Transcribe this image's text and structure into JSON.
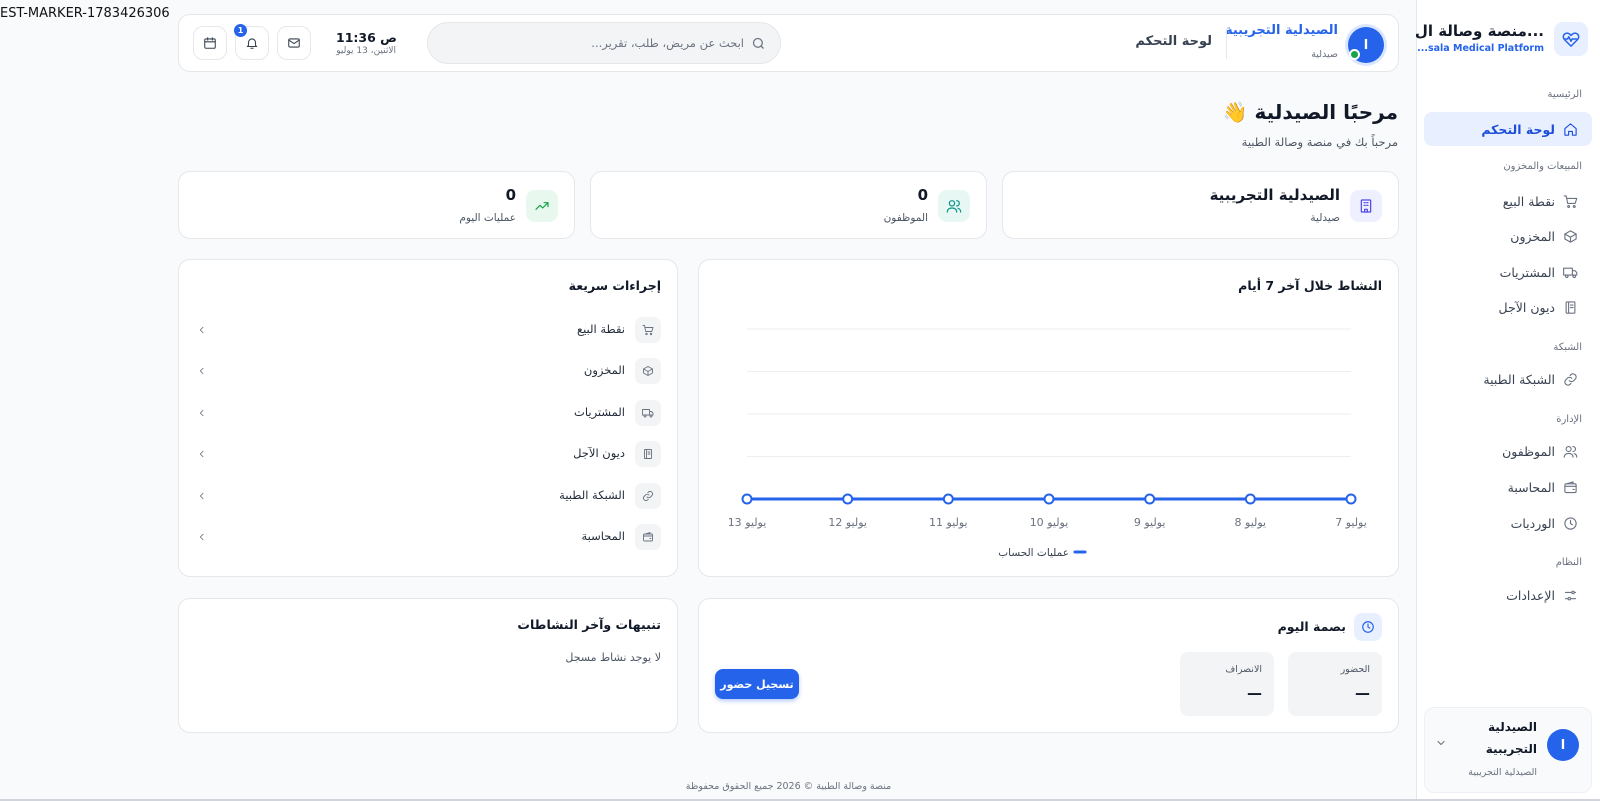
{
  "marker": "EST-MARKER-1783426306",
  "sidebar": {
    "brand_title": "منصة وصالة ال...",
    "brand_sub": "...sala Medical Platform",
    "sections": {
      "home": "الرئيسية",
      "sales": "المبيعات والمخزون",
      "network": "الشبكة",
      "admin": "الإدارة",
      "system": "النظام"
    },
    "items": [
      {
        "label": "لوحة التحكم",
        "icon": "home-icon"
      },
      {
        "label": "نقطة البيع",
        "icon": "cart-icon"
      },
      {
        "label": "المخزون",
        "icon": "box-icon"
      },
      {
        "label": "المشتريات",
        "icon": "truck-icon"
      },
      {
        "label": "ديون الآجل",
        "icon": "ledger-icon"
      },
      {
        "label": "الشبكة الطبية",
        "icon": "link-icon"
      },
      {
        "label": "الموظفون",
        "icon": "users-icon"
      },
      {
        "label": "المحاسبة",
        "icon": "wallet-icon"
      },
      {
        "label": "الورديات",
        "icon": "clock-icon"
      },
      {
        "label": "الإعدادات",
        "icon": "sliders-icon"
      }
    ],
    "user": {
      "avatar": "ا",
      "name": "الصيدلية التجريبية",
      "sub": "الصيدلية التجريبية"
    }
  },
  "header": {
    "avatar": "ا",
    "name": "الصيدلية التجريبية",
    "role": "صيدلية",
    "title": "لوحة التحكم",
    "search_placeholder": "ابحث عن مريض، طلب، تقرير...",
    "time": "11:36 ص",
    "date": "الاثنين، 13 يوليو",
    "notification_count": "1"
  },
  "welcome": {
    "title": "مرحبًا الصيدلية 👋",
    "subtitle": "مرحباً بك في منصة وصالة الطبية"
  },
  "stats": [
    {
      "value": "الصيدلية التجريبية",
      "label": "صيدلية",
      "icon": "building-icon",
      "color": "#4f46e5",
      "bg": "#eef0ff"
    },
    {
      "value": "0",
      "label": "الموظفون",
      "icon": "users-icon",
      "color": "#0d9488",
      "bg": "#e6f7f4"
    },
    {
      "value": "0",
      "label": "عمليات اليوم",
      "icon": "trending-up-icon",
      "color": "#16a34a",
      "bg": "#e8f8ee"
    }
  ],
  "chart": {
    "title": "النشاط خلال آخر 7 أيام",
    "legend": "عمليات الحساب"
  },
  "chart_data": {
    "type": "line",
    "categories": [
      "7 يوليو",
      "8 يوليو",
      "9 يوليو",
      "10 يوليو",
      "11 يوليو",
      "12 يوليو",
      "13 يوليو"
    ],
    "series": [
      {
        "name": "عمليات الحساب",
        "values": [
          0,
          0,
          0,
          0,
          0,
          0,
          0
        ]
      }
    ],
    "x_direction": "right-to-left",
    "grid": true,
    "legend_position": "bottom-center",
    "color": "#2563eb"
  },
  "quick_actions": {
    "title": "إجراءات سريعة",
    "items": [
      {
        "label": "نقطة البيع",
        "icon": "cart-icon"
      },
      {
        "label": "المخزون",
        "icon": "box-icon"
      },
      {
        "label": "المشتريات",
        "icon": "truck-icon"
      },
      {
        "label": "ديون الآجل",
        "icon": "ledger-icon"
      },
      {
        "label": "الشبكة الطبية",
        "icon": "link-icon"
      },
      {
        "label": "المحاسبة",
        "icon": "wallet-icon"
      }
    ]
  },
  "attendance": {
    "title": "بصمة اليوم",
    "checkin_label": "الحضور",
    "checkin_value": "—",
    "checkout_label": "الانصراف",
    "checkout_value": "—",
    "button": "تسجيل حضور"
  },
  "activity": {
    "title": "تنبيهات وآخر النشاطات",
    "empty": "لا يوجد نشاط مسجل"
  },
  "footer": "منصة وصالة الطبية © 2026 جميع الحقوق محفوظة"
}
